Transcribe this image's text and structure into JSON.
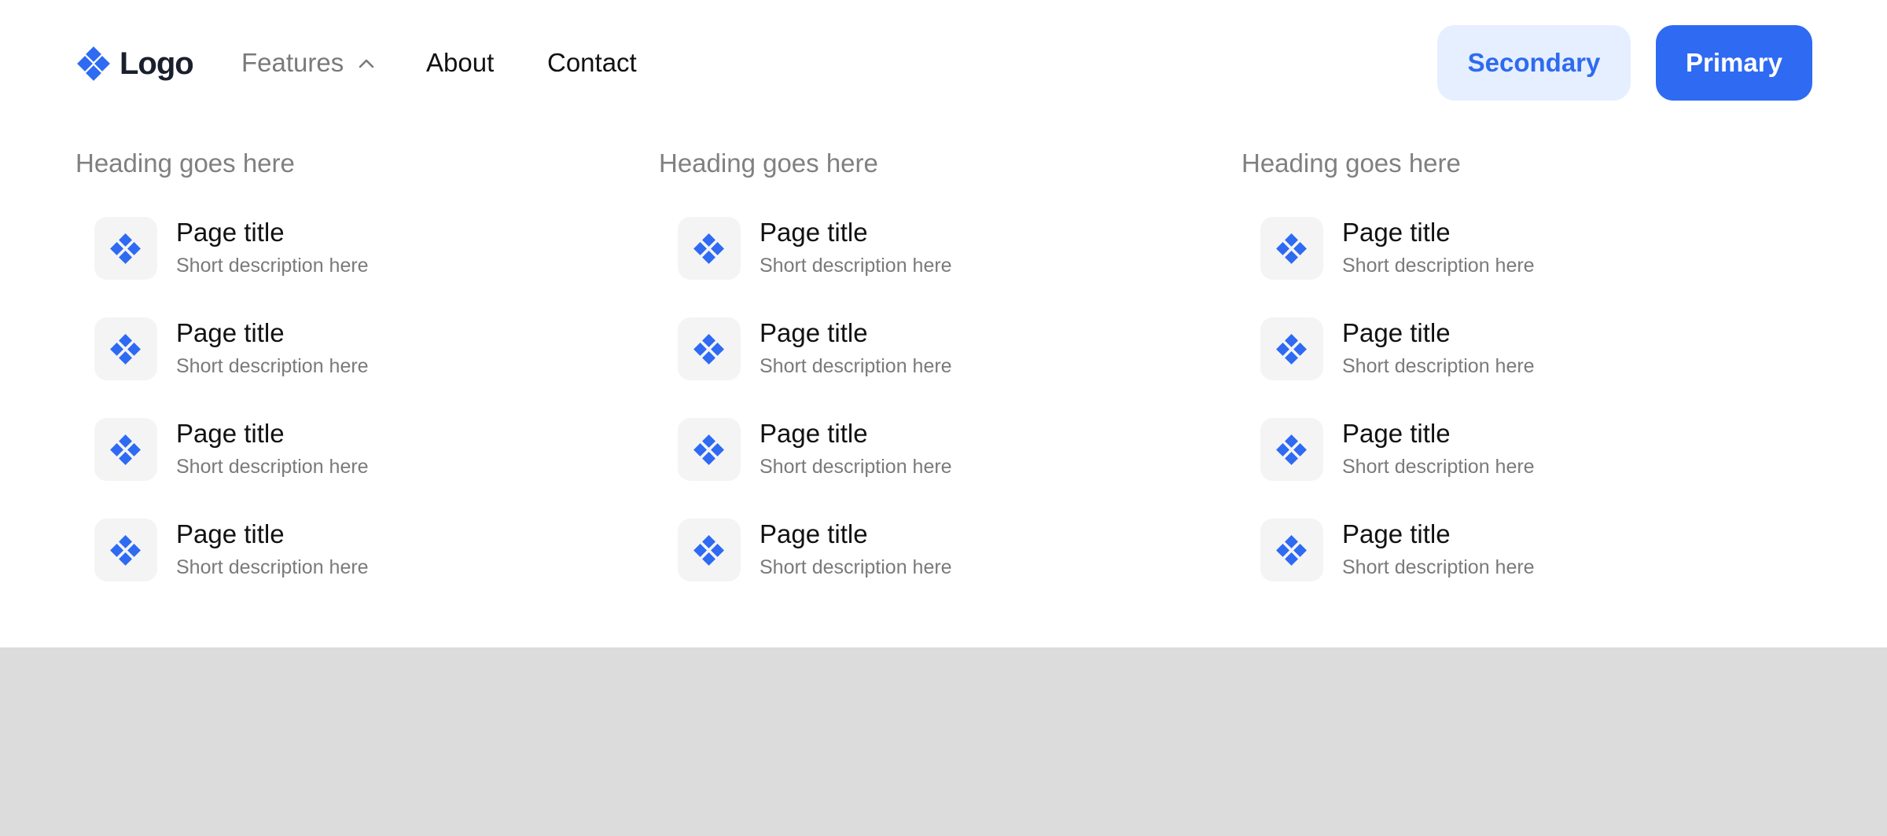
{
  "colors": {
    "accent": "#2e6af2",
    "secondary_bg": "#e6efff",
    "overlay": "#dcdcdc"
  },
  "nav": {
    "logo_text": "Logo",
    "links": [
      {
        "label": "Features",
        "icon": "chevron-up-icon"
      },
      {
        "label": "About"
      },
      {
        "label": "Contact"
      }
    ],
    "secondary_button": "Secondary",
    "primary_button": "Primary"
  },
  "menu": {
    "columns": [
      {
        "heading": "Heading goes here",
        "items": [
          {
            "title": "Page title",
            "description": "Short description here",
            "icon": "diamond-cluster-icon"
          },
          {
            "title": "Page title",
            "description": "Short description here",
            "icon": "diamond-cluster-icon"
          },
          {
            "title": "Page title",
            "description": "Short description here",
            "icon": "diamond-cluster-icon"
          },
          {
            "title": "Page title",
            "description": "Short description here",
            "icon": "diamond-cluster-icon"
          }
        ]
      },
      {
        "heading": "Heading goes here",
        "items": [
          {
            "title": "Page title",
            "description": "Short description here",
            "icon": "diamond-cluster-icon"
          },
          {
            "title": "Page title",
            "description": "Short description here",
            "icon": "diamond-cluster-icon"
          },
          {
            "title": "Page title",
            "description": "Short description here",
            "icon": "diamond-cluster-icon"
          },
          {
            "title": "Page title",
            "description": "Short description here",
            "icon": "diamond-cluster-icon"
          }
        ]
      },
      {
        "heading": "Heading goes here",
        "items": [
          {
            "title": "Page title",
            "description": "Short description here",
            "icon": "diamond-cluster-icon"
          },
          {
            "title": "Page title",
            "description": "Short description here",
            "icon": "diamond-cluster-icon"
          },
          {
            "title": "Page title",
            "description": "Short description here",
            "icon": "diamond-cluster-icon"
          },
          {
            "title": "Page title",
            "description": "Short description here",
            "icon": "diamond-cluster-icon"
          }
        ]
      }
    ]
  }
}
